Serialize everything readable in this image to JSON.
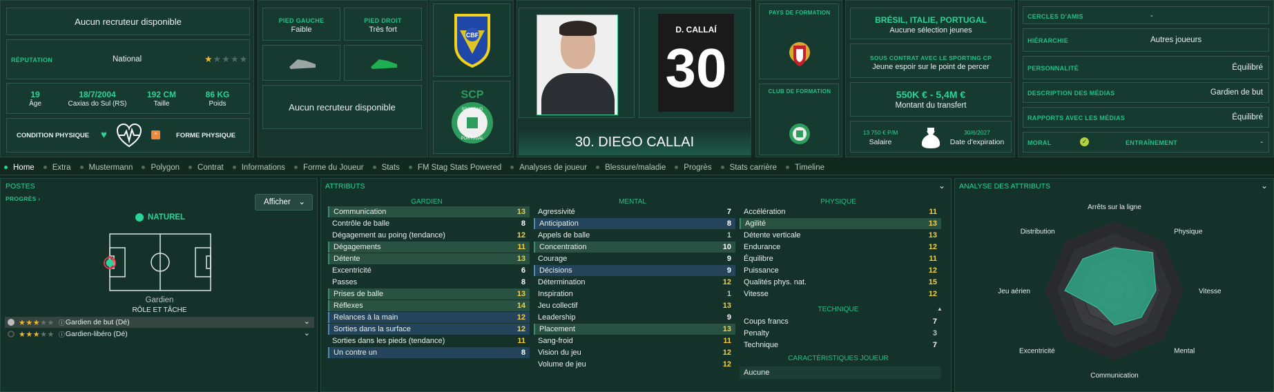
{
  "top": {
    "recruiter_top": "Aucun recruteur disponible",
    "reputation_label": "RÉPUTATION",
    "reputation_value": "National",
    "stats": [
      {
        "value": "19",
        "label": "Âge"
      },
      {
        "value": "18/7/2004",
        "label": "Caxias do Sul (RS)"
      },
      {
        "value": "192 CM",
        "label": "Taille"
      },
      {
        "value": "86 KG",
        "label": "Poids"
      }
    ],
    "condition_label": "CONDITION PHYSIQUE",
    "form_label": "FORME PHYSIQUE",
    "left_foot_label": "PIED GAUCHE",
    "left_foot_value": "Faible",
    "right_foot_label": "PIED DROIT",
    "right_foot_value": "Très fort",
    "recruiter_mid": "Aucun recruteur disponible",
    "cbf_text": "CBF",
    "scp_text": "SCP",
    "sporting_text": "SPORTING",
    "portugal_text": "PORTUGAL",
    "shirt_name": "D. CALLAÍ",
    "shirt_number": "30",
    "player_title": "30. DIEGO CALLAI",
    "training_country_label": "PAYS DE FORMATION",
    "training_club_label": "CLUB DE FORMATION",
    "nations": "BRÉSIL, ITALIE, PORTUGAL",
    "youth_selection": "Aucune sélection jeunes",
    "contract_label": "SOUS CONTRAT AVEC LE SPORTING CP",
    "contract_value": "Jeune espoir sur le point de percer",
    "transfer_value": "550K € - 5,4M €",
    "transfer_label": "Montant du transfert",
    "salary_value": "13 750 € P/M",
    "salary_label": "Salaire",
    "expiry_value": "30/6/2027",
    "expiry_label": "Date d'expiration",
    "info_rows": [
      {
        "label": "CERCLES D'AMIS",
        "value": "-"
      },
      {
        "label": "HIÉRARCHIE",
        "value": "Autres joueurs"
      },
      {
        "label": "PERSONNALITÉ",
        "value": "Équilibré"
      },
      {
        "label": "DESCRIPTION DES MÉDIAS",
        "value": "Gardien de but"
      },
      {
        "label": "RAPPORTS AVEC LES MÉDIAS",
        "value": "Équilibré"
      }
    ],
    "morale_label": "MORAL",
    "training_label": "ENTRAÎNEMENT",
    "training_value": "-"
  },
  "nav": [
    "Home",
    "Extra",
    "Mustermann",
    "Polygon",
    "Contrat",
    "Informations",
    "Forme du Joueur",
    "Stats",
    "FM Stag Stats Powered",
    "Analyses de joueur",
    "Blessure/maladie",
    "Progrès",
    "Stats carrière",
    "Timeline"
  ],
  "positions": {
    "title": "POSTES",
    "progress": "PROGRÈS",
    "button": "Afficher",
    "natural": "NATUREL",
    "position_name": "Gardien",
    "role_label": "RÔLE ET TÂCHE",
    "roles": [
      {
        "name": "Gardien de but (Dé)",
        "stars": 3
      },
      {
        "name": "Gardien-libéro (Dé)",
        "stars": 3
      }
    ]
  },
  "attributes": {
    "title": "ATTRIBUTS",
    "goalkeeper_header": "GARDIEN",
    "mental_header": "MENTAL",
    "physical_header": "PHYSIQUE",
    "technical_header": "TECHNIQUE",
    "traits_header": "CARACTÉRISTIQUES JOUEUR",
    "traits_value": "Aucune",
    "goalkeeper": [
      {
        "name": "Communication",
        "value": "13",
        "hl": "g"
      },
      {
        "name": "Contrôle de balle",
        "value": "8",
        "hl": ""
      },
      {
        "name": "Dégagement au poing (tendance)",
        "value": "12",
        "hl": ""
      },
      {
        "name": "Dégagements",
        "value": "11",
        "hl": "g"
      },
      {
        "name": "Détente",
        "value": "13",
        "hl": "g"
      },
      {
        "name": "Excentricité",
        "value": "6",
        "hl": ""
      },
      {
        "name": "Passes",
        "value": "8",
        "hl": ""
      },
      {
        "name": "Prises de balle",
        "value": "13",
        "hl": "g"
      },
      {
        "name": "Réflexes",
        "value": "14",
        "hl": "g"
      },
      {
        "name": "Relances à la main",
        "value": "12",
        "hl": "b"
      },
      {
        "name": "Sorties dans la surface",
        "value": "12",
        "hl": "b"
      },
      {
        "name": "Sorties dans les pieds (tendance)",
        "value": "11",
        "hl": ""
      },
      {
        "name": "Un contre un",
        "value": "8",
        "hl": "b"
      }
    ],
    "mental": [
      {
        "name": "Agressivité",
        "value": "7",
        "hl": ""
      },
      {
        "name": "Anticipation",
        "value": "8",
        "hl": "b"
      },
      {
        "name": "Appels de balle",
        "value": "1",
        "hl": ""
      },
      {
        "name": "Concentration",
        "value": "10",
        "hl": "g"
      },
      {
        "name": "Courage",
        "value": "9",
        "hl": ""
      },
      {
        "name": "Décisions",
        "value": "9",
        "hl": "b"
      },
      {
        "name": "Détermination",
        "value": "12",
        "hl": ""
      },
      {
        "name": "Inspiration",
        "value": "1",
        "hl": ""
      },
      {
        "name": "Jeu collectif",
        "value": "13",
        "hl": ""
      },
      {
        "name": "Leadership",
        "value": "9",
        "hl": ""
      },
      {
        "name": "Placement",
        "value": "13",
        "hl": "g"
      },
      {
        "name": "Sang-froid",
        "value": "11",
        "hl": ""
      },
      {
        "name": "Vision du jeu",
        "value": "12",
        "hl": ""
      },
      {
        "name": "Volume de jeu",
        "value": "12",
        "hl": ""
      }
    ],
    "physical": [
      {
        "name": "Accélération",
        "value": "11",
        "hl": ""
      },
      {
        "name": "Agilité",
        "value": "13",
        "hl": "g"
      },
      {
        "name": "Détente verticale",
        "value": "13",
        "hl": ""
      },
      {
        "name": "Endurance",
        "value": "12",
        "hl": ""
      },
      {
        "name": "Équilibre",
        "value": "11",
        "hl": ""
      },
      {
        "name": "Puissance",
        "value": "12",
        "hl": ""
      },
      {
        "name": "Qualités phys. nat.",
        "value": "15",
        "hl": ""
      },
      {
        "name": "Vitesse",
        "value": "12",
        "hl": ""
      }
    ],
    "technical": [
      {
        "name": "Coups francs",
        "value": "7",
        "hl": ""
      },
      {
        "name": "Penalty",
        "value": "3",
        "hl": ""
      },
      {
        "name": "Technique",
        "value": "7",
        "hl": ""
      }
    ]
  },
  "analysis": {
    "title": "ANALYSE DES ATTRIBUTS",
    "axes": [
      "Arrêts sur la ligne",
      "Physique",
      "Vitesse",
      "Mental",
      "Communication",
      "Excentricité",
      "Jeu aérien",
      "Distribution"
    ],
    "values": [
      0.62,
      0.78,
      0.6,
      0.55,
      0.5,
      0.35,
      0.72,
      0.65
    ],
    "accent": "#2fa586"
  }
}
